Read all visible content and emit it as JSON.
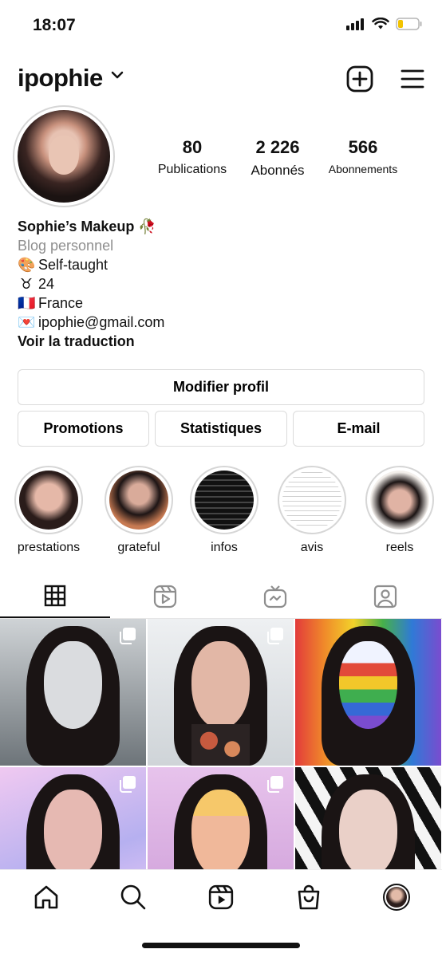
{
  "status_bar": {
    "time": "18:07"
  },
  "header": {
    "username": "ipophie"
  },
  "stats": [
    {
      "value": "80",
      "label": "Publications"
    },
    {
      "value": "2 226",
      "label": "Abonnés"
    },
    {
      "value": "566",
      "label": "Abonnements"
    }
  ],
  "bio": {
    "name": "Sophie’s Makeup 🥀",
    "category": "Blog personnel",
    "lines": [
      {
        "emoji": "🎨",
        "text": "Self-taught"
      },
      {
        "emoji": "♉",
        "text": "24"
      },
      {
        "emoji": "🇫🇷",
        "text": "France"
      },
      {
        "emoji": "💌",
        "text": "ipophie@gmail.com"
      }
    ],
    "translate": "Voir la traduction"
  },
  "buttons": {
    "edit_profile": "Modifier profil",
    "promotions": "Promotions",
    "insights": "Statistiques",
    "email": "E-mail"
  },
  "highlights": [
    {
      "label": "prestations"
    },
    {
      "label": "grateful"
    },
    {
      "label": "infos"
    },
    {
      "label": "avis"
    },
    {
      "label": "reels"
    }
  ],
  "tabs": [
    "grid-icon",
    "reels-icon",
    "igtv-icon",
    "tagged-icon"
  ],
  "grid_posts": [
    {
      "bg": "#9aa0a4",
      "face": "#d9dadc",
      "multi": true
    },
    {
      "bg": "#dfe3e6",
      "face": "#e2b7a6",
      "multi": true
    },
    {
      "bg": "#e8a23a",
      "face": "#7a5ecf",
      "multi": false
    },
    {
      "bg": "#c9b7e8",
      "face": "#e6b9b2",
      "multi": true
    },
    {
      "bg": "#d8a9e0",
      "face": "#f0b89a",
      "multi": true
    },
    {
      "bg": "#f2f2f2",
      "face": "#e8c9c0",
      "multi": false
    }
  ],
  "bottom_nav": [
    "home-icon",
    "search-icon",
    "reels-nav-icon",
    "shop-icon",
    "profile-avatar"
  ]
}
